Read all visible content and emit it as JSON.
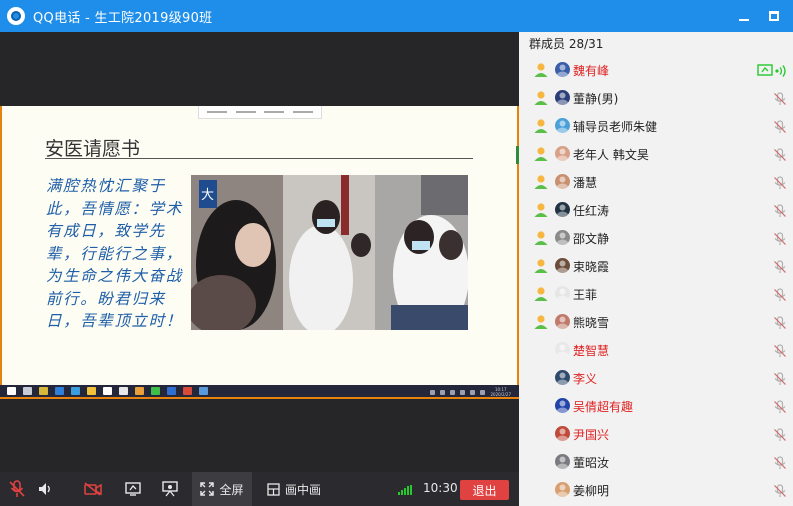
{
  "window": {
    "title": "QQ电话 - 生工院2019级90班"
  },
  "slide": {
    "title": "安医请愿书",
    "body": "满腔热忱汇聚于此，吾情愿：学术有成日，致学先辈，行能行之事，为生命之伟大奋战前行。盼君归来日，吾辈顶立时！",
    "photo_caption_icon": "大"
  },
  "taskbar": {
    "clock": "10:17",
    "date": "2020/2/27"
  },
  "controls": {
    "fullscreen_label": "全屏",
    "pip_label": "画中画",
    "duration": "10:30",
    "leave_label": "退出"
  },
  "members": {
    "header": "群成员 28/31",
    "list": [
      {
        "name": "魏有峰",
        "red": true,
        "badge": true,
        "speaking": true,
        "avatar_color": "#3a5ea8"
      },
      {
        "name": "董静(男)",
        "red": false,
        "badge": true,
        "speaking": false,
        "avatar_color": "#2c3e7a"
      },
      {
        "name": "辅导员老师朱健",
        "red": false,
        "badge": true,
        "speaking": false,
        "avatar_color": "#4aa0d8"
      },
      {
        "name": "老年人 韩文昊",
        "red": false,
        "badge": true,
        "speaking": false,
        "avatar_color": "#d9a088"
      },
      {
        "name": "潘慧",
        "red": false,
        "badge": true,
        "speaking": false,
        "avatar_color": "#c89070"
      },
      {
        "name": "任红涛",
        "red": false,
        "badge": true,
        "speaking": false,
        "avatar_color": "#223344"
      },
      {
        "name": "邵文静",
        "red": false,
        "badge": true,
        "speaking": false,
        "avatar_color": "#8a8a8a"
      },
      {
        "name": "束晓霞",
        "red": false,
        "badge": true,
        "speaking": false,
        "avatar_color": "#6b4d3a"
      },
      {
        "name": "王菲",
        "red": false,
        "badge": true,
        "speaking": false,
        "avatar_color": "#e6e6e6"
      },
      {
        "name": "熊晓雪",
        "red": false,
        "badge": true,
        "speaking": false,
        "avatar_color": "#c07a6a"
      },
      {
        "name": "楚智慧",
        "red": true,
        "badge": false,
        "speaking": false,
        "avatar_color": "#e8e8e8"
      },
      {
        "name": "李义",
        "red": true,
        "badge": false,
        "speaking": false,
        "avatar_color": "#2f4a6a"
      },
      {
        "name": "吴倩超有趣",
        "red": true,
        "badge": false,
        "speaking": false,
        "avatar_color": "#2244aa"
      },
      {
        "name": "尹国兴",
        "red": true,
        "badge": false,
        "speaking": false,
        "avatar_color": "#c04a3a"
      },
      {
        "name": "董昭汝",
        "red": false,
        "badge": false,
        "speaking": false,
        "avatar_color": "#7a7a80"
      },
      {
        "name": "姜柳明",
        "red": false,
        "badge": false,
        "speaking": false,
        "avatar_color": "#d8a070"
      }
    ]
  },
  "colors": {
    "titlebar": "#1f8eea",
    "leave_button": "#e04141",
    "slide_text": "#1f5fa8",
    "highlight_red": "#e02222",
    "speaking_green": "#26c92e"
  }
}
